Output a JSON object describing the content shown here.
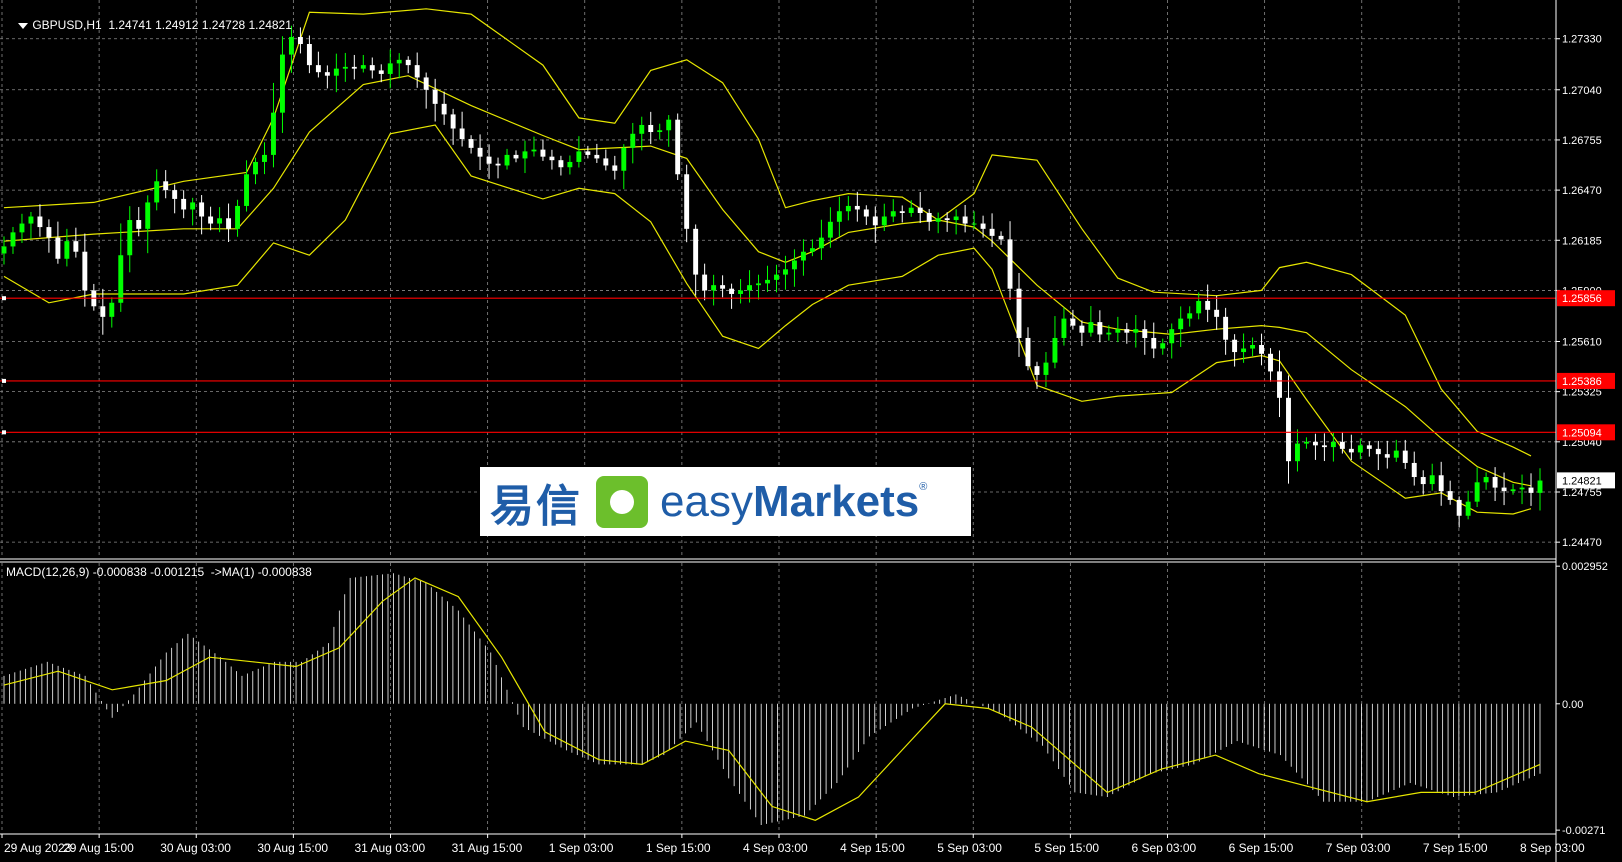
{
  "header": {
    "symbol": "GBPUSD,H1",
    "ohlc": "1.24741 1.24912 1.24728 1.24821"
  },
  "macd_label": "MACD(12,26,9) -0.000838 -0.001215  ->MA(1) -0.000838",
  "colors": {
    "background": "#000000",
    "grid": "#8a8a8a",
    "bull": "#00ff00",
    "bear": "#ffffff",
    "bollinger": "#e6e600",
    "level_line": "#ff0000",
    "macd_signal": "#e6e600"
  },
  "logo": {
    "cn": "易信",
    "en_light": "easy",
    "en_bold": "Markets",
    "reg": "®"
  },
  "chart_data": [
    {
      "type": "candlestick",
      "title": "GBPUSD,H1",
      "y_ticks": [
        "1.27330",
        "1.27040",
        "1.26755",
        "1.26470",
        "1.26185",
        "1.25900",
        "1.25610",
        "1.25325",
        "1.25040",
        "1.24755",
        "1.24470"
      ],
      "ylim": [
        1.2438,
        1.2755
      ],
      "x_ticks": [
        "29 Aug 2023",
        "29 Aug 15:00",
        "30 Aug 03:00",
        "30 Aug 15:00",
        "31 Aug 03:00",
        "31 Aug 15:00",
        "1 Sep 03:00",
        "1 Sep 15:00",
        "4 Sep 03:00",
        "4 Sep 15:00",
        "5 Sep 03:00",
        "5 Sep 15:00",
        "6 Sep 03:00",
        "6 Sep 15:00",
        "7 Sep 03:00",
        "7 Sep 15:00",
        "8 Sep 03:00"
      ],
      "horizontal_levels": [
        {
          "value": 1.25856,
          "label": "1.25856"
        },
        {
          "value": 1.25386,
          "label": "1.25386"
        },
        {
          "value": 1.25094,
          "label": "1.25094"
        }
      ],
      "current_price": {
        "value": 1.24821,
        "label": "1.24821"
      },
      "closes": [
        1.2615,
        1.2623,
        1.2628,
        1.2632,
        1.2626,
        1.262,
        1.2608,
        1.2618,
        1.2612,
        1.259,
        1.2581,
        1.2575,
        1.2583,
        1.261,
        1.263,
        1.2625,
        1.264,
        1.2652,
        1.2647,
        1.2642,
        1.2636,
        1.264,
        1.2632,
        1.2628,
        1.2631,
        1.2625,
        1.2638,
        1.2656,
        1.2663,
        1.2667,
        1.2691,
        1.2724,
        1.2734,
        1.273,
        1.2718,
        1.2714,
        1.2712,
        1.2716,
        1.2717,
        1.2716,
        1.2718,
        1.2715,
        1.2713,
        1.2719,
        1.2721,
        1.2718,
        1.2711,
        1.2704,
        1.2696,
        1.269,
        1.2682,
        1.2676,
        1.2671,
        1.2666,
        1.2662,
        1.2661,
        1.2667,
        1.2665,
        1.2669,
        1.267,
        1.2666,
        1.2664,
        1.266,
        1.2663,
        1.2669,
        1.2667,
        1.2665,
        1.2661,
        1.2658,
        1.2671,
        1.2679,
        1.2684,
        1.268,
        1.2681,
        1.2687,
        1.2656,
        1.2625,
        1.2599,
        1.259,
        1.2593,
        1.2591,
        1.2588,
        1.259,
        1.2593,
        1.2594,
        1.2596,
        1.2599,
        1.2602,
        1.2607,
        1.2612,
        1.2614,
        1.262,
        1.2629,
        1.2635,
        1.2638,
        1.2636,
        1.2632,
        1.2627,
        1.2632,
        1.2635,
        1.2634,
        1.2637,
        1.2634,
        1.2629,
        1.2631,
        1.263,
        1.2632,
        1.2628,
        1.2628,
        1.2625,
        1.2621,
        1.2619,
        1.2591,
        1.2563,
        1.2547,
        1.2542,
        1.2549,
        1.2563,
        1.2574,
        1.257,
        1.2566,
        1.2572,
        1.2565,
        1.2566,
        1.2568,
        1.2566,
        1.2568,
        1.2563,
        1.2557,
        1.256,
        1.2568,
        1.2574,
        1.2577,
        1.2584,
        1.2579,
        1.2575,
        1.2562,
        1.2555,
        1.2557,
        1.2559,
        1.2554,
        1.2544,
        1.2529,
        1.2493,
        1.2503,
        1.2504,
        1.2502,
        1.2501,
        1.2504,
        1.25,
        1.2498,
        1.2502,
        1.25,
        1.2497,
        1.2495,
        1.2499,
        1.2492,
        1.2484,
        1.248,
        1.2485,
        1.2476,
        1.2471,
        1.2462,
        1.247,
        1.2481,
        1.2484,
        1.2478,
        1.2476,
        1.2477,
        1.2478,
        1.2475,
        1.2482
      ],
      "bollinger": {
        "period": 20,
        "upper": [
          [
            0,
            1.2637
          ],
          [
            10,
            1.264
          ],
          [
            20,
            1.2652
          ],
          [
            27,
            1.2657
          ],
          [
            30,
            1.2688
          ],
          [
            34,
            1.2748
          ],
          [
            40,
            1.2747
          ],
          [
            47,
            1.275
          ],
          [
            52,
            1.2747
          ],
          [
            60,
            1.2718
          ],
          [
            64,
            1.2688
          ],
          [
            68,
            1.2685
          ],
          [
            72,
            1.2715
          ],
          [
            76,
            1.2721
          ],
          [
            80,
            1.2708
          ],
          [
            84,
            1.2676
          ],
          [
            87,
            1.2637
          ],
          [
            90,
            1.2641
          ],
          [
            94,
            1.2645
          ],
          [
            100,
            1.2643
          ],
          [
            104,
            1.263
          ],
          [
            108,
            1.2645
          ],
          [
            110,
            1.2667
          ],
          [
            115,
            1.2664
          ],
          [
            120,
            1.2625
          ],
          [
            124,
            1.2597
          ],
          [
            128,
            1.2589
          ],
          [
            135,
            1.2587
          ],
          [
            140,
            1.259
          ],
          [
            142,
            1.2603
          ],
          [
            145,
            1.2606
          ],
          [
            150,
            1.2599
          ],
          [
            156,
            1.2576
          ],
          [
            160,
            1.2534
          ],
          [
            164,
            1.251
          ],
          [
            168,
            1.2501
          ],
          [
            170,
            1.2496
          ]
        ],
        "middle": [
          [
            0,
            1.2618
          ],
          [
            10,
            1.2622
          ],
          [
            20,
            1.2625
          ],
          [
            26,
            1.2625
          ],
          [
            30,
            1.2648
          ],
          [
            34,
            1.268
          ],
          [
            40,
            1.2707
          ],
          [
            45,
            1.2712
          ],
          [
            52,
            1.2695
          ],
          [
            60,
            1.2678
          ],
          [
            64,
            1.267
          ],
          [
            68,
            1.2671
          ],
          [
            72,
            1.2672
          ],
          [
            76,
            1.2665
          ],
          [
            80,
            1.2636
          ],
          [
            84,
            1.2612
          ],
          [
            87,
            1.2606
          ],
          [
            90,
            1.2612
          ],
          [
            94,
            1.2623
          ],
          [
            100,
            1.2628
          ],
          [
            104,
            1.263
          ],
          [
            108,
            1.2626
          ],
          [
            110,
            1.2618
          ],
          [
            115,
            1.2593
          ],
          [
            120,
            1.2572
          ],
          [
            124,
            1.2568
          ],
          [
            130,
            1.2565
          ],
          [
            135,
            1.2568
          ],
          [
            140,
            1.257
          ],
          [
            142,
            1.2569
          ],
          [
            145,
            1.2566
          ],
          [
            150,
            1.2545
          ],
          [
            156,
            1.2524
          ],
          [
            160,
            1.2506
          ],
          [
            164,
            1.249
          ],
          [
            168,
            1.2481
          ],
          [
            170,
            1.2479
          ]
        ],
        "lower": [
          [
            0,
            1.2598
          ],
          [
            5,
            1.2583
          ],
          [
            10,
            1.2588
          ],
          [
            20,
            1.2588
          ],
          [
            26,
            1.2593
          ],
          [
            30,
            1.2617
          ],
          [
            34,
            1.261
          ],
          [
            38,
            1.263
          ],
          [
            43,
            1.2679
          ],
          [
            48,
            1.2684
          ],
          [
            52,
            1.2655
          ],
          [
            60,
            1.2642
          ],
          [
            64,
            1.2648
          ],
          [
            68,
            1.2645
          ],
          [
            72,
            1.2629
          ],
          [
            76,
            1.2594
          ],
          [
            80,
            1.2564
          ],
          [
            84,
            1.2557
          ],
          [
            87,
            1.257
          ],
          [
            90,
            1.2582
          ],
          [
            94,
            1.2593
          ],
          [
            100,
            1.2598
          ],
          [
            104,
            1.261
          ],
          [
            108,
            1.2614
          ],
          [
            110,
            1.2602
          ],
          [
            115,
            1.2536
          ],
          [
            120,
            1.2527
          ],
          [
            124,
            1.253
          ],
          [
            130,
            1.2532
          ],
          [
            135,
            1.2549
          ],
          [
            140,
            1.2553
          ],
          [
            142,
            1.255
          ],
          [
            145,
            1.2528
          ],
          [
            150,
            1.2493
          ],
          [
            156,
            1.2472
          ],
          [
            160,
            1.2475
          ],
          [
            164,
            1.2464
          ],
          [
            168,
            1.2463
          ],
          [
            170,
            1.2466
          ]
        ]
      }
    },
    {
      "type": "histogram+line",
      "title": "MACD(12,26,9)",
      "y_ticks": [
        "0.002952",
        "0.00",
        "-0.00271"
      ],
      "ylim": [
        -0.00275,
        0.00302
      ],
      "histogram": [
        [
          0,
          0.0006
        ],
        [
          8,
          0.0009
        ],
        [
          15,
          0.0006
        ],
        [
          20,
          -0.0003
        ],
        [
          24,
          0.0002
        ],
        [
          30,
          0.0011
        ],
        [
          34,
          0.0015
        ],
        [
          40,
          0.001
        ],
        [
          44,
          0.0006
        ],
        [
          50,
          0.0009
        ],
        [
          55,
          0.0009
        ],
        [
          60,
          0.0013
        ],
        [
          64,
          0.0027
        ],
        [
          72,
          0.0028
        ],
        [
          78,
          0.0026
        ],
        [
          84,
          0.002
        ],
        [
          90,
          0.0011
        ],
        [
          96,
          -0.0005
        ],
        [
          104,
          -0.001
        ],
        [
          110,
          -0.0013
        ],
        [
          118,
          -0.0013
        ],
        [
          122,
          -0.0011
        ],
        [
          128,
          -0.0004
        ],
        [
          134,
          -0.0016
        ],
        [
          140,
          -0.0026
        ],
        [
          148,
          -0.0024
        ],
        [
          154,
          -0.0017
        ],
        [
          160,
          -0.0007
        ],
        [
          168,
          -0.0001
        ],
        [
          176,
          0.0002
        ],
        [
          184,
          -0.0002
        ],
        [
          192,
          -0.0009
        ],
        [
          198,
          -0.0019
        ],
        [
          204,
          -0.002
        ],
        [
          212,
          -0.0015
        ],
        [
          220,
          -0.0013
        ],
        [
          228,
          -0.0008
        ],
        [
          236,
          -0.0011
        ],
        [
          244,
          -0.0021
        ],
        [
          252,
          -0.0021
        ],
        [
          260,
          -0.0017
        ],
        [
          268,
          -0.002
        ],
        [
          276,
          -0.0019
        ],
        [
          284,
          -0.0015
        ]
      ],
      "signal": [
        [
          0,
          0.0004
        ],
        [
          10,
          0.0007
        ],
        [
          20,
          0.0003
        ],
        [
          30,
          0.0005
        ],
        [
          38,
          0.001
        ],
        [
          46,
          0.0009
        ],
        [
          54,
          0.0008
        ],
        [
          62,
          0.0012
        ],
        [
          70,
          0.0022
        ],
        [
          76,
          0.0027
        ],
        [
          84,
          0.0023
        ],
        [
          92,
          0.001
        ],
        [
          100,
          -0.0006
        ],
        [
          110,
          -0.0012
        ],
        [
          118,
          -0.0013
        ],
        [
          126,
          -0.0008
        ],
        [
          134,
          -0.001
        ],
        [
          142,
          -0.0022
        ],
        [
          150,
          -0.0025
        ],
        [
          158,
          -0.002
        ],
        [
          166,
          -0.001
        ],
        [
          174,
          0.0
        ],
        [
          182,
          -0.0001
        ],
        [
          190,
          -0.0005
        ],
        [
          196,
          -0.0011
        ],
        [
          204,
          -0.0019
        ],
        [
          214,
          -0.0014
        ],
        [
          224,
          -0.0011
        ],
        [
          232,
          -0.0015
        ],
        [
          242,
          -0.0018
        ],
        [
          252,
          -0.0021
        ],
        [
          262,
          -0.0019
        ],
        [
          272,
          -0.0019
        ],
        [
          284,
          -0.0013
        ]
      ]
    }
  ]
}
